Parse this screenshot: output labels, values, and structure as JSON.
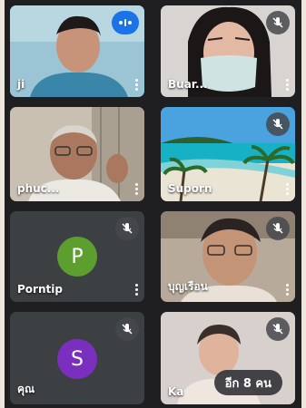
{
  "participants": [
    {
      "name": "ji",
      "mic": "active"
    },
    {
      "name": "Buar...",
      "mic": "muted"
    },
    {
      "name": "phuc...",
      "mic": "none"
    },
    {
      "name": "Suporn",
      "mic": "muted"
    },
    {
      "name": "Porntip",
      "mic": "muted",
      "avatar_letter": "P",
      "avatar_color": "#5d9f2f"
    },
    {
      "name": "บุญเรือน",
      "mic": "muted"
    },
    {
      "name": "คุณ",
      "mic": "muted",
      "avatar_letter": "S",
      "avatar_color": "#7b2fbf"
    },
    {
      "name": "Ka",
      "mic": "muted"
    }
  ],
  "more_participants_label": "อีก 8 คน",
  "colors": {
    "accent": "#1a73e8",
    "tile_bg": "#3c4043"
  }
}
